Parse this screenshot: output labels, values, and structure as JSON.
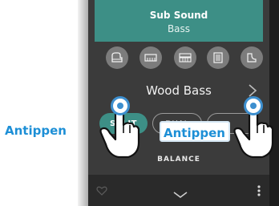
{
  "sub_sound": {
    "title": "Sub Sound",
    "category": "Bass"
  },
  "category_icons": [
    "grand-piano-icon",
    "electric-piano-icon",
    "organ-icon",
    "harpsichord-icon",
    "strings-icon"
  ],
  "voice": {
    "name": "Wood Bass"
  },
  "mode_buttons": {
    "split_label": "SPLIT",
    "dual_label": "DUAL"
  },
  "balance": {
    "label": "BALANCE"
  },
  "callouts": {
    "left": "Antippen",
    "right": "Antippen"
  },
  "colors": {
    "accent_teal": "#3d8f86",
    "callout_blue": "#1d8fd6",
    "panel_dark": "#3b3b3b",
    "bar_dark": "#2a2a2a"
  }
}
